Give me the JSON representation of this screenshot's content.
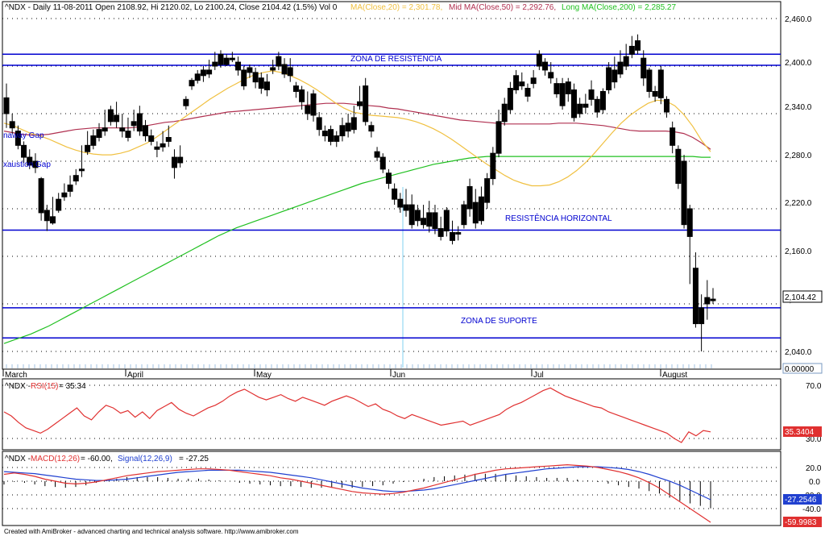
{
  "header": {
    "symbol_line": "^NDX - Daily 11-08-2011 Open 2108.92, Hi 2120.02, Lo 2100.24, Close 2104.42 (1.5%) Vol 0",
    "ma20": "MA(Close,20) = 2,301.78,",
    "ma50": "Mid MA(Close,50) = 2,292.76,",
    "ma200": "Long MA(Close,200) = 2,285.27"
  },
  "annotations": {
    "resistance_zone": "ZONA DE RESISTÊNCIA",
    "horizontal_resistance": "RESISTÊNCIA HORIZONTAL",
    "support_zone": "ZONA DE SUPORTE",
    "runaway_gap": "naway Gap",
    "exhaustion_gap": "xaustion Gap"
  },
  "price_panel": {
    "y_ticks": [
      "2,460.0",
      "2,400.0",
      "2,340.0",
      "2,280.0",
      "2,220.0",
      "2,160.0",
      "2,100.0",
      "2,040.0"
    ],
    "last_price_label": "2,104.42",
    "volume_label": "0.00000",
    "month_labels": [
      "March",
      "April",
      "May",
      "Jun",
      "Jul",
      "August"
    ]
  },
  "rsi_panel": {
    "title_prefix": "^NDX - ",
    "title_series": "RSI(15)",
    "title_value": " = 35.34",
    "y_ticks": [
      "70.0",
      "30.0"
    ],
    "last_label": "35.3404"
  },
  "macd_panel": {
    "title_prefix": "^NDX - ",
    "title_macd": "MACD(12,26)",
    "title_mid": " = -60.00, ",
    "title_signal": "Signal(12,26,9)",
    "title_end": " = -27.25",
    "y_ticks": [
      "20.0",
      "0.0",
      "-20.0",
      "-40.0"
    ],
    "signal_label": "-27.2546",
    "macd_label": "-59.9983"
  },
  "footer": "Created with AmiBroker - advanced charting and technical analysis software. http://www.amibroker.com",
  "colors": {
    "ma20": "#f0c040",
    "ma50": "#b03050",
    "ma200": "#20c020",
    "hline": "#0000d0",
    "rsi": "#e03030",
    "macd": "#e03030",
    "signal": "#2040d0"
  },
  "chart_data": {
    "type": "candlestick",
    "price_axis": {
      "ylim": [
        2020,
        2480
      ],
      "ticks": [
        2460,
        2400,
        2340,
        2280,
        2220,
        2160,
        2100,
        2040
      ]
    },
    "levels": {
      "resistance_zone": [
        2415,
        2401
      ],
      "horizontal_resistance": 2193,
      "support_zone": [
        2095,
        2057
      ]
    },
    "candles": [
      [
        2360,
        2378,
        2340,
        2322
      ],
      [
        2330,
        2340,
        2322,
        2315
      ],
      [
        2318,
        2325,
        2300,
        2295
      ],
      [
        2300,
        2305,
        2285,
        2278
      ],
      [
        2285,
        2295,
        2275,
        2270
      ],
      [
        2280,
        2290,
        2272,
        2265
      ],
      [
        2258,
        2260,
        2215,
        2205
      ],
      [
        2218,
        2225,
        2205,
        2192
      ],
      [
        2210,
        2235,
        2202,
        2200
      ],
      [
        2232,
        2240,
        2218,
        2215
      ],
      [
        2240,
        2252,
        2235,
        2230
      ],
      [
        2250,
        2262,
        2242,
        2235
      ],
      [
        2262,
        2270,
        2255,
        2250
      ],
      [
        2270,
        2300,
        2268,
        2260
      ],
      [
        2300,
        2318,
        2292,
        2288
      ],
      [
        2312,
        2320,
        2300,
        2295
      ],
      [
        2320,
        2328,
        2310,
        2305
      ],
      [
        2322,
        2345,
        2318,
        2312
      ],
      [
        2345,
        2350,
        2330,
        2325
      ],
      [
        2338,
        2355,
        2330,
        2322
      ],
      [
        2322,
        2340,
        2318,
        2310
      ],
      [
        2318,
        2335,
        2310,
        2305
      ],
      [
        2330,
        2345,
        2325,
        2318
      ],
      [
        2340,
        2350,
        2318,
        2312
      ],
      [
        2325,
        2332,
        2312,
        2305
      ],
      [
        2312,
        2320,
        2305,
        2300
      ],
      [
        2298,
        2305,
        2295,
        2285
      ],
      [
        2302,
        2318,
        2298,
        2292
      ],
      [
        2310,
        2325,
        2305,
        2298
      ],
      [
        2285,
        2295,
        2272,
        2258
      ],
      [
        2285,
        2300,
        2278,
        2272
      ],
      [
        2358,
        2362,
        2350,
        2345
      ],
      [
        2382,
        2385,
        2375,
        2370
      ],
      [
        2390,
        2395,
        2382,
        2378
      ],
      [
        2395,
        2400,
        2388,
        2380
      ],
      [
        2395,
        2408,
        2390,
        2385
      ],
      [
        2405,
        2418,
        2400,
        2395
      ],
      [
        2415,
        2420,
        2402,
        2398
      ],
      [
        2410,
        2415,
        2402,
        2400
      ],
      [
        2410,
        2418,
        2408,
        2405
      ],
      [
        2405,
        2412,
        2395,
        2388
      ],
      [
        2395,
        2400,
        2375,
        2370
      ],
      [
        2398,
        2402,
        2392,
        2385
      ],
      [
        2392,
        2398,
        2380,
        2372
      ],
      [
        2385,
        2392,
        2372,
        2365
      ],
      [
        2380,
        2390,
        2370,
        2362
      ],
      [
        2398,
        2408,
        2395,
        2390
      ],
      [
        2412,
        2418,
        2400,
        2395
      ],
      [
        2402,
        2410,
        2390,
        2385
      ],
      [
        2398,
        2410,
        2388,
        2380
      ],
      [
        2375,
        2380,
        2368,
        2360
      ],
      [
        2370,
        2375,
        2355,
        2345
      ],
      [
        2350,
        2368,
        2340,
        2332
      ],
      [
        2365,
        2370,
        2338,
        2330
      ],
      [
        2335,
        2342,
        2320,
        2312
      ],
      [
        2318,
        2325,
        2312,
        2305
      ],
      [
        2320,
        2325,
        2305,
        2300
      ],
      [
        2312,
        2318,
        2305,
        2298
      ],
      [
        2325,
        2335,
        2312,
        2305
      ],
      [
        2328,
        2340,
        2318,
        2310
      ],
      [
        2335,
        2350,
        2320,
        2315
      ],
      [
        2355,
        2375,
        2350,
        2345
      ],
      [
        2375,
        2385,
        2330,
        2325
      ],
      [
        2325,
        2330,
        2318,
        2310
      ],
      [
        2292,
        2298,
        2285,
        2280
      ],
      [
        2285,
        2290,
        2270,
        2265
      ],
      [
        2265,
        2270,
        2252,
        2245
      ],
      [
        2245,
        2252,
        2232,
        2225
      ],
      [
        2232,
        2240,
        2222,
        2215
      ],
      [
        2225,
        2245,
        2218,
        2210
      ],
      [
        2225,
        2238,
        2200,
        2195
      ],
      [
        2218,
        2225,
        2205,
        2198
      ],
      [
        2208,
        2225,
        2200,
        2195
      ],
      [
        2215,
        2230,
        2198,
        2190
      ],
      [
        2215,
        2225,
        2195,
        2188
      ],
      [
        2195,
        2210,
        2185,
        2180
      ],
      [
        2218,
        2222,
        2192,
        2185
      ],
      [
        2190,
        2205,
        2180,
        2175
      ],
      [
        2190,
        2198,
        2188,
        2180
      ],
      [
        2225,
        2230,
        2200,
        2195
      ],
      [
        2248,
        2258,
        2220,
        2210
      ],
      [
        2228,
        2245,
        2202,
        2195
      ],
      [
        2235,
        2248,
        2205,
        2200
      ],
      [
        2258,
        2265,
        2228,
        2220
      ],
      [
        2290,
        2298,
        2258,
        2250
      ],
      [
        2330,
        2345,
        2290,
        2285
      ],
      [
        2352,
        2360,
        2330,
        2325
      ],
      [
        2372,
        2380,
        2345,
        2340
      ],
      [
        2388,
        2395,
        2370,
        2365
      ],
      [
        2380,
        2392,
        2375,
        2370
      ],
      [
        2372,
        2378,
        2362,
        2355
      ],
      [
        2385,
        2395,
        2378,
        2372
      ],
      [
        2415,
        2420,
        2400,
        2395
      ],
      [
        2405,
        2410,
        2395,
        2388
      ],
      [
        2392,
        2405,
        2385,
        2378
      ],
      [
        2378,
        2385,
        2365,
        2360
      ],
      [
        2378,
        2385,
        2350,
        2345
      ],
      [
        2380,
        2385,
        2365,
        2355
      ],
      [
        2370,
        2378,
        2335,
        2330
      ],
      [
        2352,
        2360,
        2340,
        2335
      ],
      [
        2352,
        2365,
        2348,
        2340
      ],
      [
        2370,
        2382,
        2358,
        2350
      ],
      [
        2358,
        2362,
        2342,
        2335
      ],
      [
        2368,
        2372,
        2345,
        2340
      ],
      [
        2398,
        2405,
        2370,
        2365
      ],
      [
        2395,
        2412,
        2380,
        2372
      ],
      [
        2405,
        2420,
        2390,
        2385
      ],
      [
        2412,
        2428,
        2400,
        2395
      ],
      [
        2425,
        2438,
        2415,
        2410
      ],
      [
        2432,
        2440,
        2420,
        2415
      ],
      [
        2410,
        2420,
        2385,
        2375
      ],
      [
        2395,
        2398,
        2368,
        2360
      ],
      [
        2368,
        2375,
        2362,
        2355
      ],
      [
        2395,
        2400,
        2360,
        2352
      ],
      [
        2358,
        2362,
        2342,
        2335
      ],
      [
        2322,
        2330,
        2300,
        2290
      ],
      [
        2295,
        2300,
        2252,
        2245
      ],
      [
        2280,
        2288,
        2200,
        2195
      ],
      [
        2220,
        2225,
        2185,
        2125
      ],
      [
        2145,
        2165,
        2075,
        2070
      ],
      [
        2095,
        2112,
        2075,
        2040
      ],
      [
        2108,
        2130,
        2100,
        2080
      ],
      [
        2106,
        2120,
        2104,
        2100
      ]
    ],
    "x_months": [
      "March",
      "April",
      "May",
      "Jun",
      "Jul",
      "August"
    ],
    "ma20": [
      2328,
      2325,
      2320,
      2315,
      2312,
      2308,
      2303,
      2298,
      2294,
      2291,
      2289,
      2288,
      2288,
      2290,
      2293,
      2298,
      2303,
      2310,
      2318,
      2326,
      2334,
      2342,
      2350,
      2358,
      2365,
      2372,
      2378,
      2384,
      2389,
      2392,
      2394,
      2392,
      2388,
      2383,
      2377,
      2370,
      2362,
      2354,
      2347,
      2342,
      2340,
      2338,
      2337,
      2336,
      2335,
      2333,
      2330,
      2326,
      2321,
      2315,
      2308,
      2300,
      2292,
      2284,
      2276,
      2269,
      2262,
      2256,
      2252,
      2249,
      2249,
      2250,
      2254,
      2260,
      2268,
      2278,
      2290,
      2303,
      2316,
      2328,
      2338,
      2346,
      2353,
      2357,
      2356,
      2350,
      2339,
      2324,
      2306,
      2292
    ],
    "ma50": [
      2318,
      2316,
      2314,
      2313,
      2313,
      2314,
      2316,
      2318,
      2320,
      2321,
      2322,
      2322,
      2322,
      2322,
      2322,
      2323,
      2325,
      2327,
      2329,
      2330,
      2332,
      2334,
      2336,
      2338,
      2340,
      2342,
      2343,
      2344,
      2345,
      2346,
      2347,
      2348,
      2349,
      2350,
      2351,
      2352,
      2353,
      2353,
      2353,
      2352,
      2351,
      2350,
      2349,
      2347,
      2346,
      2344,
      2342,
      2340,
      2338,
      2336,
      2334,
      2332,
      2331,
      2330,
      2329,
      2328,
      2327,
      2327,
      2327,
      2327,
      2327,
      2327,
      2328,
      2328,
      2328,
      2327,
      2326,
      2325,
      2323,
      2321,
      2319,
      2318,
      2318,
      2318,
      2318,
      2317,
      2315,
      2310,
      2303,
      2295
    ],
    "ma200": [
      2050,
      2054,
      2058,
      2062,
      2067,
      2072,
      2078,
      2084,
      2090,
      2096,
      2102,
      2108,
      2114,
      2120,
      2126,
      2132,
      2138,
      2144,
      2150,
      2156,
      2162,
      2168,
      2174,
      2180,
      2186,
      2191,
      2196,
      2200,
      2204,
      2208,
      2212,
      2216,
      2220,
      2224,
      2228,
      2232,
      2236,
      2240,
      2244,
      2248,
      2252,
      2255,
      2258,
      2261,
      2264,
      2267,
      2270,
      2273,
      2276,
      2278,
      2280,
      2282,
      2284,
      2285,
      2286,
      2286,
      2286,
      2286,
      2286,
      2286,
      2286,
      2286,
      2286,
      2286,
      2286,
      2286,
      2286,
      2286,
      2286,
      2286,
      2286,
      2286,
      2286,
      2286,
      2286,
      2286,
      2286,
      2286,
      2285,
      2285
    ],
    "rsi": {
      "ylim": [
        20,
        80
      ],
      "values": [
        50,
        47,
        42,
        38,
        36,
        34,
        37,
        41,
        45,
        49,
        53,
        47,
        44,
        50,
        55,
        53,
        49,
        51,
        46,
        50,
        45,
        51,
        54,
        57,
        52,
        49,
        47,
        50,
        53,
        55,
        58,
        62,
        65,
        67,
        64,
        61,
        59,
        61,
        63,
        60,
        58,
        61,
        59,
        57,
        55,
        58,
        60,
        62,
        60,
        57,
        54,
        56,
        52,
        50,
        47,
        45,
        48,
        46,
        44,
        42,
        40,
        41,
        42,
        43,
        40,
        42,
        44,
        46,
        48,
        52,
        55,
        57,
        60,
        63,
        66,
        68,
        65,
        62,
        60,
        58,
        56,
        54,
        53,
        50,
        48,
        46,
        44,
        42,
        40,
        38,
        36,
        34,
        30,
        27,
        35,
        32,
        36,
        35
      ]
    },
    "macd": {
      "ylim": [
        -60,
        30
      ],
      "macd": [
        10,
        12,
        10,
        7,
        3,
        0,
        -3,
        -4,
        -3,
        -1,
        2,
        5,
        8,
        10,
        12,
        14,
        15,
        16,
        17,
        18,
        18,
        17,
        16,
        14,
        12,
        10,
        8,
        5,
        3,
        0,
        -3,
        -6,
        -9,
        -12,
        -15,
        -17,
        -18,
        -19,
        -18,
        -16,
        -13,
        -10,
        -6,
        -2,
        2,
        6,
        10,
        13,
        16,
        18,
        19,
        20,
        21,
        22,
        23,
        24,
        23,
        22,
        20,
        17,
        14,
        10,
        5,
        -2,
        -10,
        -20,
        -30,
        -40,
        -50,
        -60
      ],
      "signal": [
        14,
        13,
        12,
        11,
        9,
        7,
        5,
        3,
        2,
        1,
        1,
        2,
        3,
        5,
        7,
        9,
        11,
        13,
        14,
        15,
        16,
        16,
        16,
        16,
        15,
        14,
        13,
        11,
        9,
        7,
        5,
        2,
        -1,
        -4,
        -7,
        -10,
        -12,
        -14,
        -15,
        -15,
        -14,
        -13,
        -11,
        -8,
        -5,
        -2,
        1,
        4,
        7,
        10,
        12,
        14,
        16,
        18,
        19,
        20,
        21,
        21,
        21,
        20,
        19,
        17,
        14,
        10,
        5,
        0,
        -6,
        -13,
        -20,
        -27
      ]
    }
  }
}
